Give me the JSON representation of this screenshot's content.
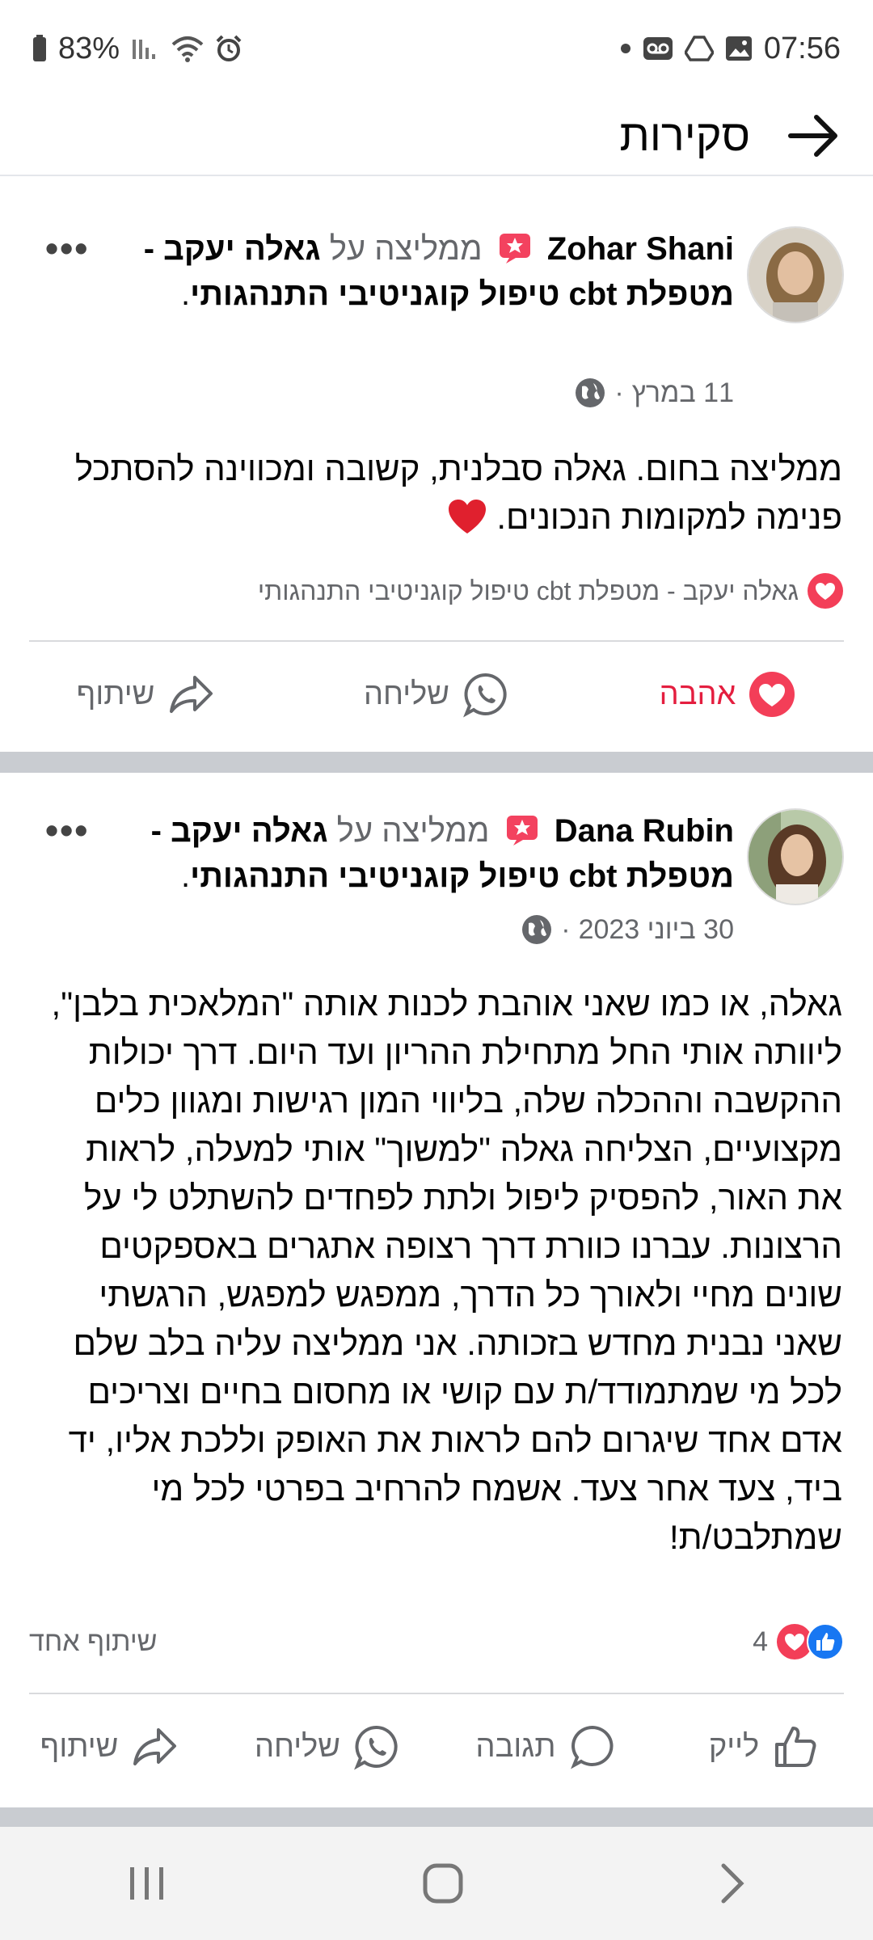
{
  "status_bar": {
    "battery": "83%",
    "time": "07:56"
  },
  "app_bar": {
    "title": "סקירות"
  },
  "posts": [
    {
      "author": "Zohar Shani",
      "recommends": "ממליצה על",
      "page_name": "גאלה יעקב - מטפלת cbt טיפול קוגניטיבי התנהגותי",
      "date": "11 במרץ",
      "text_lines": [
        "ממליצה בחום. גאלה סבלנית, קשובה ומכווינה להסתכל",
        "פנימה למקומות הנכונים."
      ],
      "reaction_by": "גאלה יעקב - מטפלת cbt טיפול קוגניטיבי התנהגותי",
      "actions": {
        "love": "אהבה",
        "send": "שליחה",
        "share": "שיתוף"
      }
    },
    {
      "author": "Dana Rubin",
      "recommends": "ממליצה על",
      "page_name": "גאלה יעקב - מטפלת cbt טיפול קוגניטיבי התנהגותי",
      "date": "30 ביוני 2023",
      "text_lines": [
        "גאלה, או כמו שאני אוהבת לכנות אותה \"המלאכית בלבן\",",
        "ליוותה אותי החל מתחילת ההריון ועד היום. דרך יכולות",
        "ההקשבה וההכלה שלה, בליווי המון רגישות ומגוון כלים",
        "מקצועיים, הצליחה גאלה \"למשוך\" אותי למעלה, לראות",
        "את האור, להפסיק ליפול ולתת לפחדים להשתלט לי על",
        "הרצונות. עברנו כוורת דרך רצופה אתגרים באספקטים",
        "שונים מחיי ולאורך כל הדרך, ממפגש למפגש, הרגשתי",
        "שאני נבנית מחדש בזכותה. אני ממליצה עליה בלב שלם",
        "לכל מי שמתמודד/ת עם קושי או מחסום בחיים וצריכים",
        "אדם אחד שיגרום להם לראות את האופק וללכת אליו, יד",
        "ביד, צעד אחר צעד. אשמח להרחיב בפרטי לכל מי",
        "שמתלבט/ת!"
      ],
      "reaction_count": "4",
      "shares": "שיתוף אחד",
      "actions": {
        "like": "לייק",
        "comment": "תגובה",
        "send": "שליחה",
        "share": "שיתוף"
      }
    }
  ],
  "colors": {
    "love": "#e41e3f",
    "like": "#1877f2",
    "secondary_text": "#65676b",
    "separator": "#c9ccd1"
  }
}
